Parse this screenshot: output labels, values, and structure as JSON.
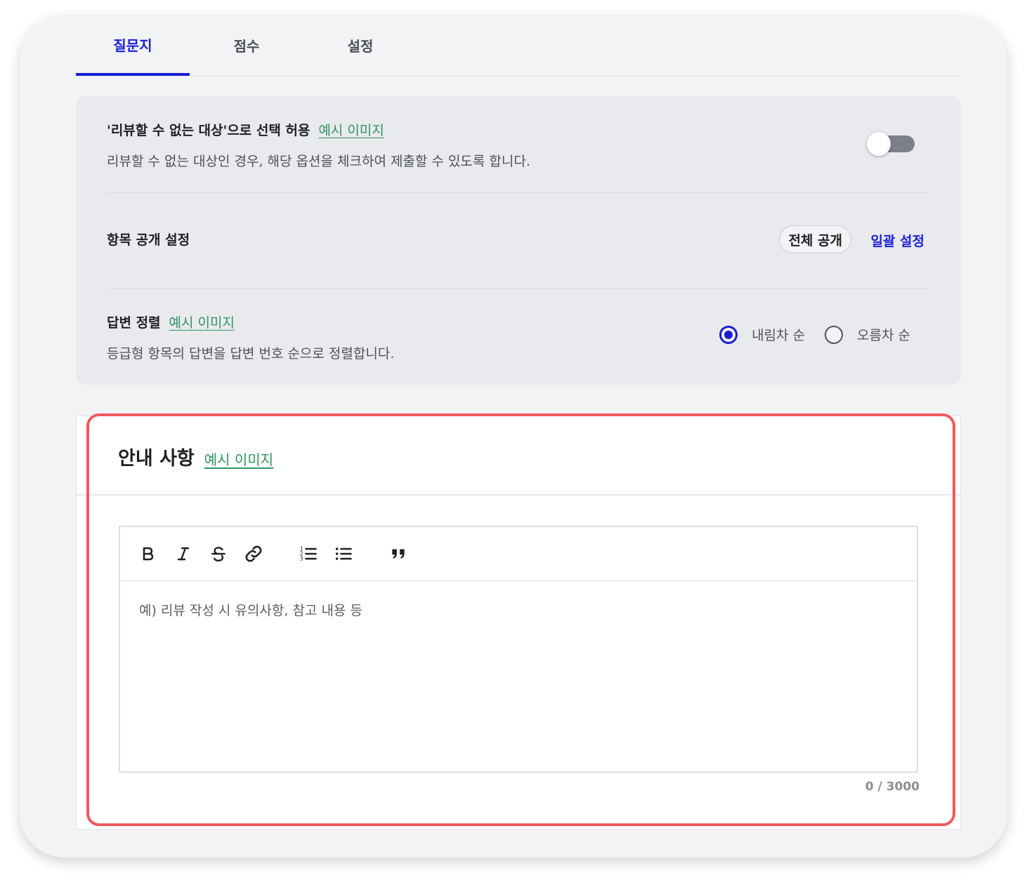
{
  "tabs": [
    {
      "label": "질문지",
      "active": true
    },
    {
      "label": "점수",
      "active": false
    },
    {
      "label": "설정",
      "active": false
    }
  ],
  "settings": {
    "not_reviewable": {
      "title": "'리뷰할 수 없는 대상'으로 선택 허용",
      "example_link": "예시 이미지",
      "description": "리뷰할 수 없는 대상인 경우, 해당 옵션을 체크하여 제출할 수 있도록 합니다.",
      "enabled": false
    },
    "visibility": {
      "title": "항목 공개 설정",
      "current_value": "전체 공개",
      "bulk_button": "일괄 설정"
    },
    "answer_sort": {
      "title": "답변 정렬",
      "example_link": "예시 이미지",
      "description": "등급형 항목의 답변을 답변 번호 순으로 정렬합니다.",
      "options": [
        {
          "label": "내림차 순",
          "selected": true
        },
        {
          "label": "오름차 순",
          "selected": false
        }
      ]
    }
  },
  "notice": {
    "title": "안내 사항",
    "example_link": "예시 이미지",
    "placeholder": "예) 리뷰 작성 시 유의사항, 참고 내용 등",
    "counter": "0 / 3000",
    "toolbar": [
      "bold-icon",
      "italic-icon",
      "strikethrough-icon",
      "link-icon",
      "ordered-list-icon",
      "bullet-list-icon",
      "quote-icon"
    ]
  },
  "colors": {
    "accent": "#1a1fd6",
    "link": "#2f9461",
    "highlight": "#ee5a5f"
  }
}
